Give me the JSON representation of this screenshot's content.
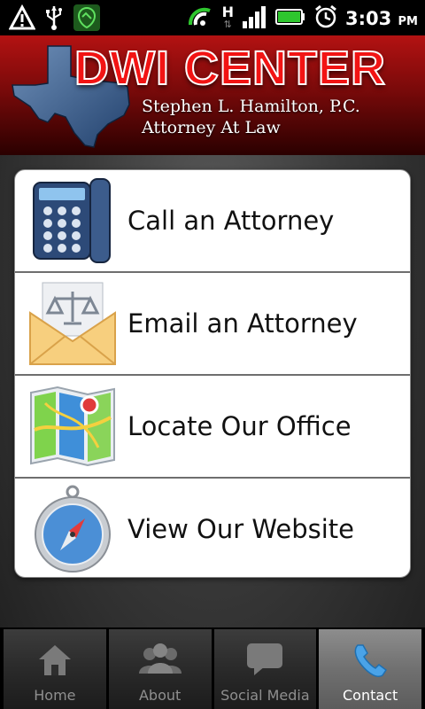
{
  "status_bar": {
    "time": "3:03",
    "ampm": "PM",
    "network": "H",
    "icons": [
      "warning-icon",
      "usb-icon",
      "shield-icon",
      "wifi-icon",
      "signal-icon",
      "battery-icon",
      "alarm-icon"
    ]
  },
  "header": {
    "title": "DWI CENTER",
    "subtitle_line1": "Stephen L. Hamilton, P.C.",
    "subtitle_line2": "Attorney At Law"
  },
  "menu": {
    "items": [
      {
        "label": "Call an Attorney",
        "icon": "phone-icon"
      },
      {
        "label": "Email an Attorney",
        "icon": "email-scales-icon"
      },
      {
        "label": "Locate Our Office",
        "icon": "map-icon"
      },
      {
        "label": "View Our Website",
        "icon": "compass-icon"
      }
    ]
  },
  "tabs": [
    {
      "label": "Home",
      "icon": "home-icon",
      "active": false
    },
    {
      "label": "About",
      "icon": "people-icon",
      "active": false
    },
    {
      "label": "Social Media",
      "icon": "speech-bubble-icon",
      "active": false
    },
    {
      "label": "Contact",
      "icon": "phone-handset-icon",
      "active": true
    }
  ],
  "colors": {
    "header_red": "#b31212",
    "title_red": "#f21414",
    "tab_active": "#707070",
    "tab_label": "#8f8f8f"
  }
}
